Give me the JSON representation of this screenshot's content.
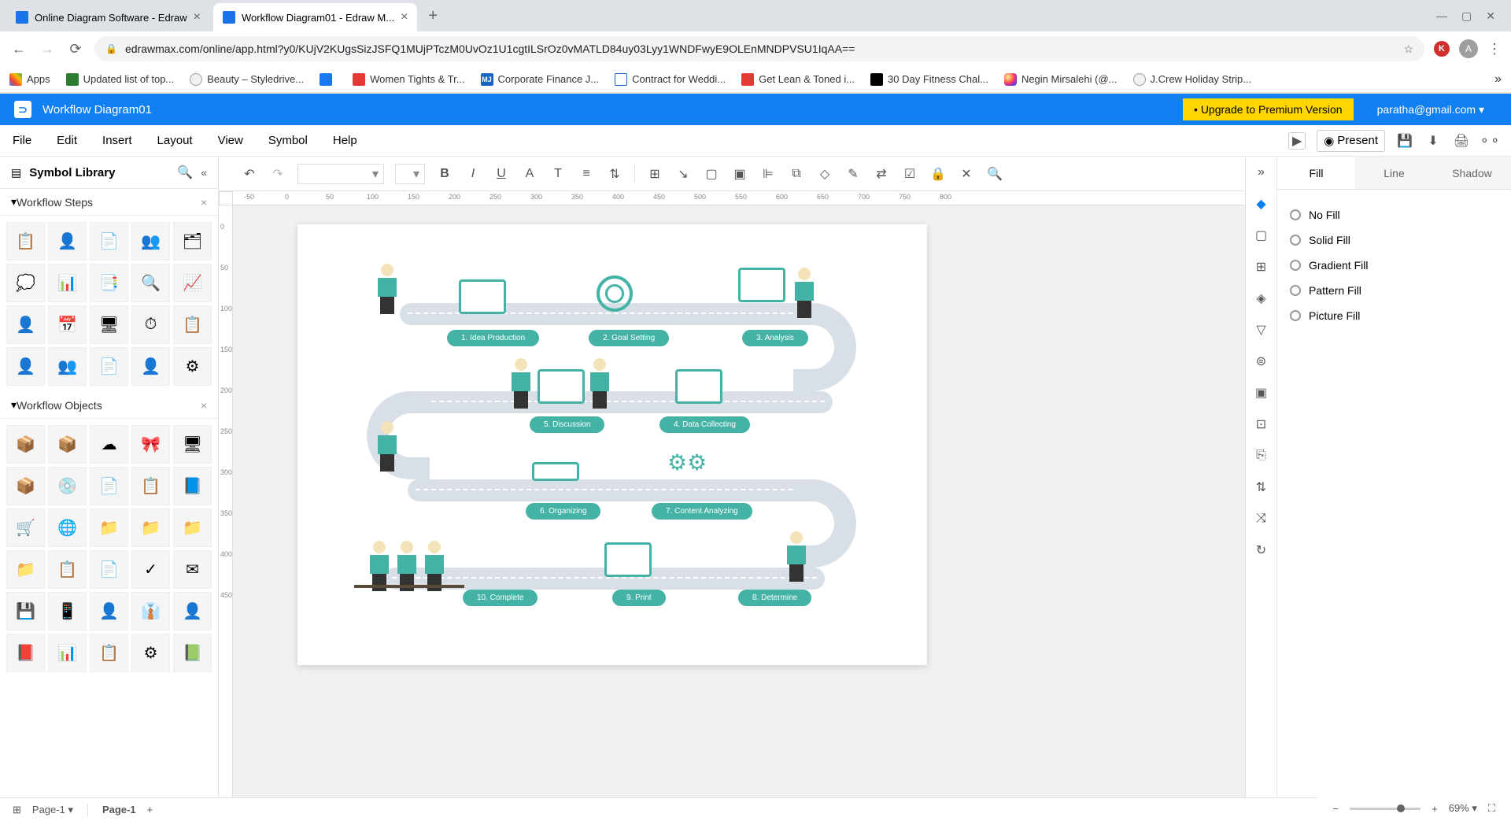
{
  "browser": {
    "tabs": [
      {
        "title": "Online Diagram Software - Edraw"
      },
      {
        "title": "Workflow Diagram01 - Edraw M..."
      }
    ],
    "url": "edrawmax.com/online/app.html?y0/KUjV2KUgsSizJSFQ1MUjPTczM0UvOz1U1cgtILSrOz0vMATLD84uy03Lyy1WNDFwyE9OLEnMNDPVSU1IqAA==",
    "bookmarks": [
      {
        "label": "Apps"
      },
      {
        "label": "Updated list of top..."
      },
      {
        "label": "Beauty – Styledrive..."
      },
      {
        "label": ""
      },
      {
        "label": "Women Tights & Tr..."
      },
      {
        "label": "Corporate Finance J..."
      },
      {
        "label": "Contract for Weddi..."
      },
      {
        "label": "Get Lean & Toned i..."
      },
      {
        "label": "30 Day Fitness Chal..."
      },
      {
        "label": "Negin Mirsalehi (@..."
      },
      {
        "label": "J.Crew Holiday Strip..."
      }
    ]
  },
  "app": {
    "title": "Workflow Diagram01",
    "upgrade": "• Upgrade to Premium Version",
    "user": "paratha@gmail.com"
  },
  "menu": [
    "File",
    "Edit",
    "Insert",
    "Layout",
    "View",
    "Symbol",
    "Help"
  ],
  "present": "Present",
  "sidebar": {
    "title": "Symbol Library",
    "sections": [
      {
        "name": "Workflow Steps"
      },
      {
        "name": "Workflow Objects"
      }
    ]
  },
  "diagram": {
    "steps": [
      "1. Idea Production",
      "2. Goal Setting",
      "3. Analysis",
      "4. Data Collecting",
      "5. Discussion",
      "6. Organizing",
      "7. Content Analyzing",
      "8. Determine",
      "9. Print",
      "10. Complete"
    ]
  },
  "rightPanel": {
    "tabs": [
      "Fill",
      "Line",
      "Shadow"
    ],
    "fillOptions": [
      "No Fill",
      "Solid Fill",
      "Gradient Fill",
      "Pattern Fill",
      "Picture Fill"
    ]
  },
  "pageTabs": {
    "selector": "Page-1",
    "current": "Page-1"
  },
  "zoom": "69%"
}
